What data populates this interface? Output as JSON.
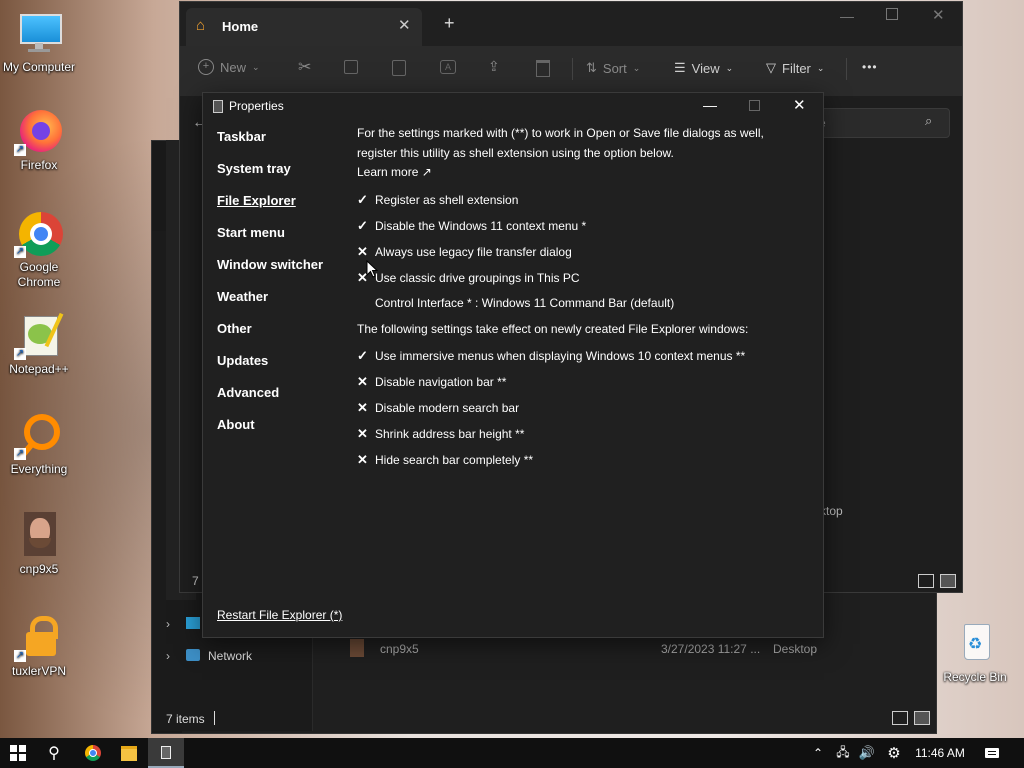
{
  "desktop": {
    "icons": [
      {
        "label": "My Computer"
      },
      {
        "label": "Firefox"
      },
      {
        "label": "Google Chrome"
      },
      {
        "label": "Notepad++"
      },
      {
        "label": "Everything"
      },
      {
        "label": "cnp9x5"
      },
      {
        "label": "tuxlerVPN"
      },
      {
        "label": "Recycle Bin"
      }
    ]
  },
  "explorer": {
    "tab_title": "Home",
    "toolbar": {
      "new_label": "New",
      "sort_label": "Sort",
      "view_label": "View",
      "filter_label": "Filter",
      "more_label": "•••"
    },
    "search_placeholder": "e",
    "left_count": "7",
    "desktop_label_partial": "ktop"
  },
  "explorer_back": {
    "network_label": "Network",
    "file_row": {
      "name": "cnp9x5",
      "date": "3/27/2023 11:27 ...",
      "location": "Desktop"
    },
    "status": "7 items"
  },
  "properties": {
    "title": "Properties",
    "nav": [
      "Taskbar",
      "System tray",
      "File Explorer",
      "Start menu",
      "Window switcher",
      "Weather",
      "Other",
      "Updates",
      "Advanced",
      "About"
    ],
    "intro": "For the settings marked with (**) to work in Open or Save file dialogs as well, register this utility as shell extension using the option below.",
    "learn_more": "Learn more ↗",
    "options": [
      {
        "mark": "✓",
        "label": "Register as shell extension"
      },
      {
        "mark": "✓",
        "label": "Disable the Windows 11 context menu *"
      },
      {
        "mark": "✕",
        "label": "Always use legacy file transfer dialog"
      },
      {
        "mark": "✕",
        "label": "Use classic drive groupings in This PC"
      },
      {
        "mark": "",
        "label": "Control Interface * : Windows 11 Command Bar (default)"
      }
    ],
    "section_note": "The following settings take effect on newly created File Explorer windows:",
    "options2": [
      {
        "mark": "✓",
        "label": "Use immersive menus when displaying Windows 10 context menus **"
      },
      {
        "mark": "✕",
        "label": "Disable navigation bar **"
      },
      {
        "mark": "✕",
        "label": "Disable modern search bar"
      },
      {
        "mark": "✕",
        "label": "Shrink address bar height **"
      },
      {
        "mark": "✕",
        "label": "Hide search bar completely **"
      }
    ],
    "restart_link": "Restart File Explorer (*)"
  },
  "taskbar": {
    "time": "11:46 AM"
  }
}
